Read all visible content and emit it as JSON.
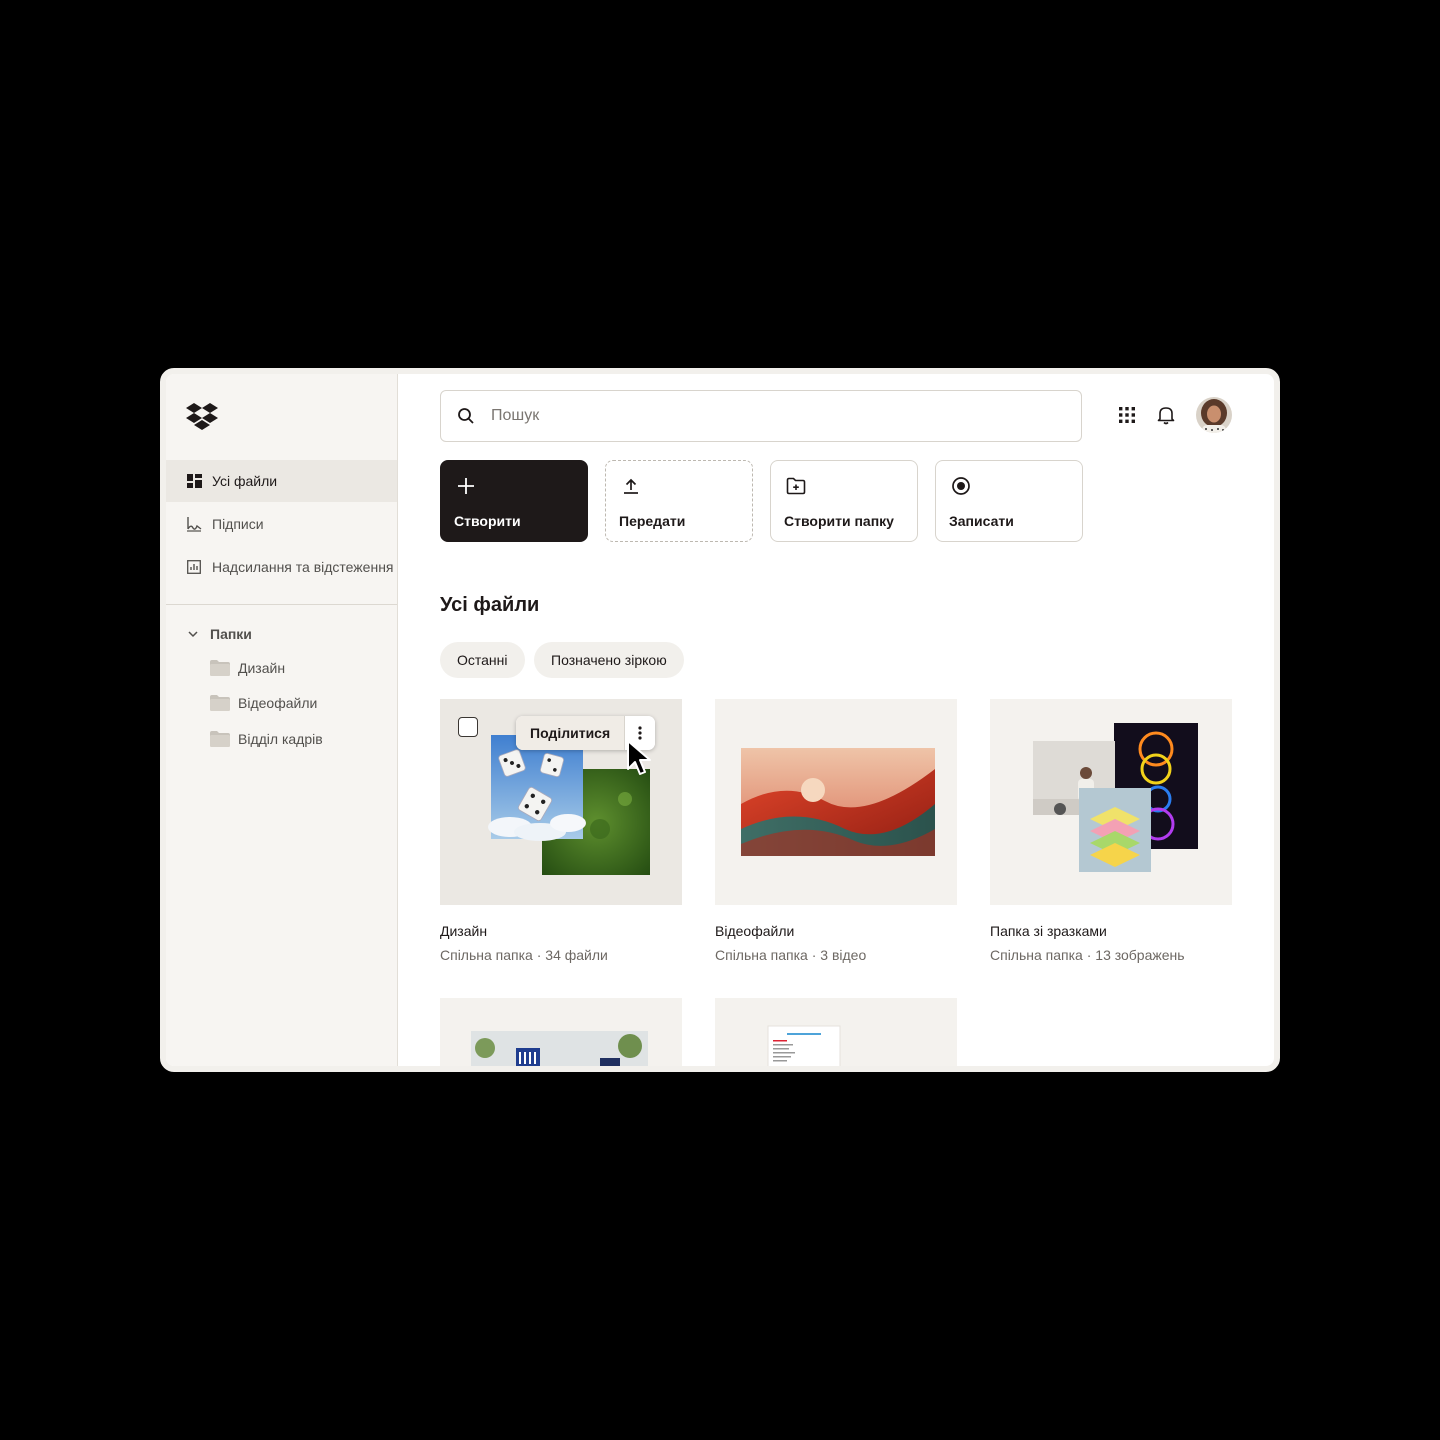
{
  "sidebar": {
    "logo_icon": "dropbox-logo-icon",
    "nav": [
      {
        "label": "Усі файли",
        "icon": "all-files-icon",
        "active": true
      },
      {
        "label": "Підписи",
        "icon": "signature-icon",
        "active": false
      },
      {
        "label": "Надсилання та відстеження",
        "icon": "chart-icon",
        "active": false
      }
    ],
    "folders_heading": "Папки",
    "folders": [
      {
        "label": "Дизайн",
        "icon": "folder-icon"
      },
      {
        "label": "Відеофайли",
        "icon": "folder-icon"
      },
      {
        "label": "Відділ кадрів",
        "icon": "folder-icon"
      }
    ]
  },
  "header": {
    "search_placeholder": "Пошук",
    "icons": [
      "apps-grid-icon",
      "bell-icon",
      "avatar"
    ]
  },
  "actions": [
    {
      "label": "Створити",
      "icon": "plus-icon"
    },
    {
      "label": "Передати",
      "icon": "upload-icon"
    },
    {
      "label": "Створити папку",
      "icon": "new-folder-icon"
    },
    {
      "label": "Записати",
      "icon": "record-icon"
    }
  ],
  "section_title": "Усі файли",
  "chips": [
    "Останні",
    "Позначено зіркою"
  ],
  "cards": [
    {
      "title": "Дизайн",
      "subtitle": "Спільна папка · 34 файли"
    },
    {
      "title": "Відеофайли",
      "subtitle": "Спільна папка · 3 відео"
    },
    {
      "title": "Папка зі зразками",
      "subtitle": "Спільна папка · 13 зображень"
    }
  ],
  "hover_actions": {
    "share_label": "Поділитися",
    "more_icon": "more-vertical-icon",
    "checkbox_icon": "checkbox-icon"
  },
  "colors": {
    "primary": "#1e1919",
    "sidebar_bg": "#f7f5f2",
    "active_bg": "#ebe8e3"
  }
}
